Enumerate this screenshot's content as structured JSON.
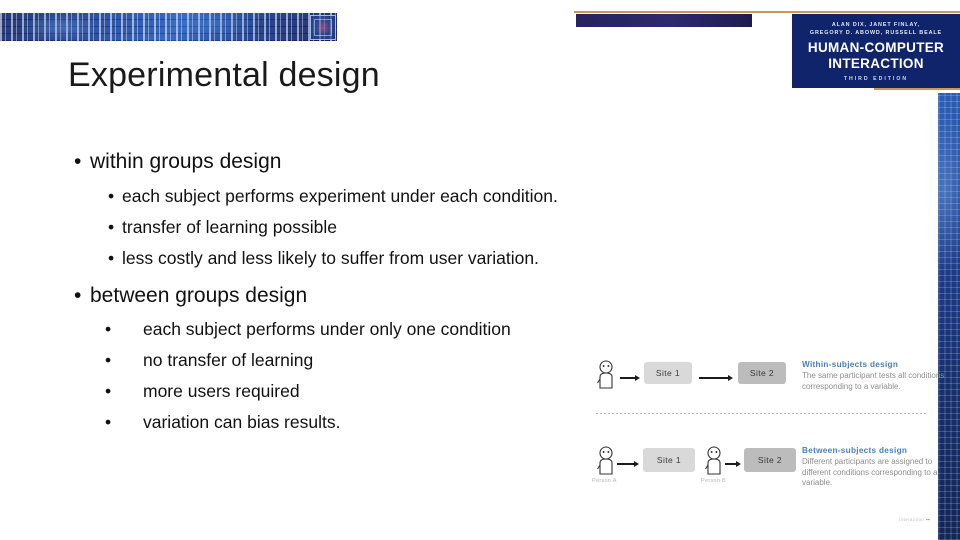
{
  "slide": {
    "title": "Experimental design"
  },
  "header": {
    "binary_band_name": "binary-pattern-band",
    "emblem_name": "band-emblem-icon",
    "navy_bar_name": "navy-accent-bar"
  },
  "book_cover": {
    "authors_line1": "ALAN DIX, JANET FINLAY,",
    "authors_line2": "GREGORY D. ABOWD, RUSSELL BEALE",
    "title_line1": "HUMAN-COMPUTER",
    "title_line2": "INTERACTION",
    "edition": "THIRD EDITION"
  },
  "body": {
    "groups": [
      {
        "heading": "within groups design",
        "bullet": "•",
        "items": [
          "each subject performs experiment under each condition.",
          "transfer of learning possible",
          "less costly and less likely to suffer from user variation."
        ]
      },
      {
        "heading": "between groups design",
        "bullet": "•",
        "items": [
          "each subject performs under only one condition",
          "no transfer of learning",
          "more users required",
          "variation can bias results."
        ]
      }
    ]
  },
  "diagram": {
    "within": {
      "site_1": "Site 1",
      "site_2": "Site 2",
      "caption_title": "Within-subjects design",
      "caption_body": "The same participant tests all conditions corresponding to a variable."
    },
    "between": {
      "site_1": "Site 1",
      "site_2": "Site 2",
      "person_a": "Person A",
      "person_b": "Person B",
      "caption_title": "Between-subjects design",
      "caption_body": "Different participants are assigned to different conditions corresponding to a variable."
    },
    "watermark_text": "interaction",
    "watermark_mark": "▪▪"
  },
  "colors": {
    "accent_tan": "#c89a57",
    "navy": "#26235e",
    "caption_blue": "#4a7fb5",
    "site_light": "#d9d9d9",
    "site_dark": "#bcbcbc"
  }
}
